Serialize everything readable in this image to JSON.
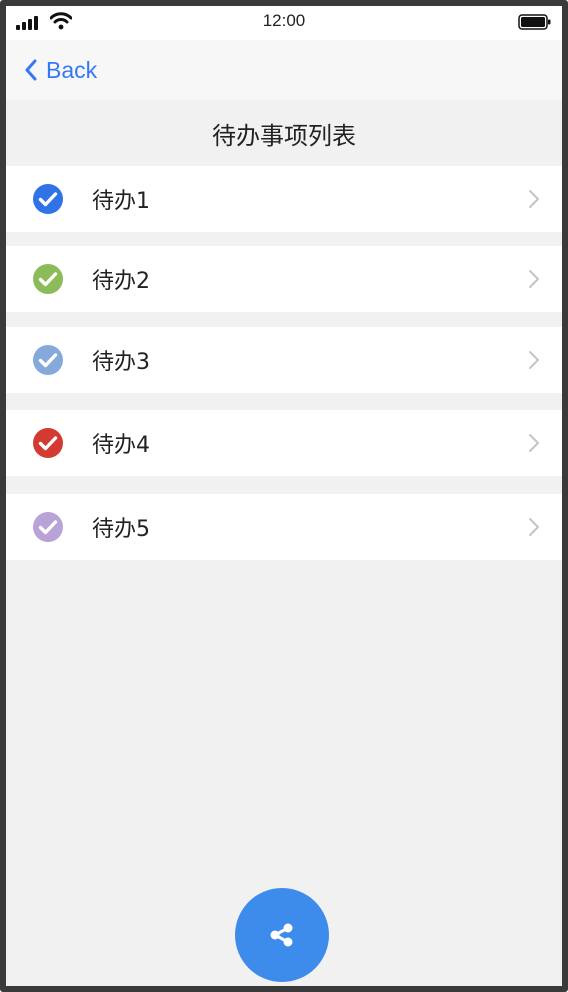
{
  "status_bar": {
    "time": "12:00"
  },
  "nav": {
    "back_label": "Back"
  },
  "page": {
    "title": "待办事项列表"
  },
  "todos": [
    {
      "label": "待办1",
      "color": "#2f73e6"
    },
    {
      "label": "待办2",
      "color": "#8cbc5a"
    },
    {
      "label": "待办3",
      "color": "#86a9dc"
    },
    {
      "label": "待办4",
      "color": "#d23a32"
    },
    {
      "label": "待办5",
      "color": "#b9a2d8"
    }
  ],
  "theme": {
    "accent": "#3478f6",
    "fab": "#3d8bea",
    "background": "#f1f1f1"
  },
  "icons": [
    "signal-icon",
    "wifi-icon",
    "battery-icon",
    "chevron-left-icon",
    "check-circle-icon",
    "chevron-right-icon",
    "share-icon"
  ]
}
